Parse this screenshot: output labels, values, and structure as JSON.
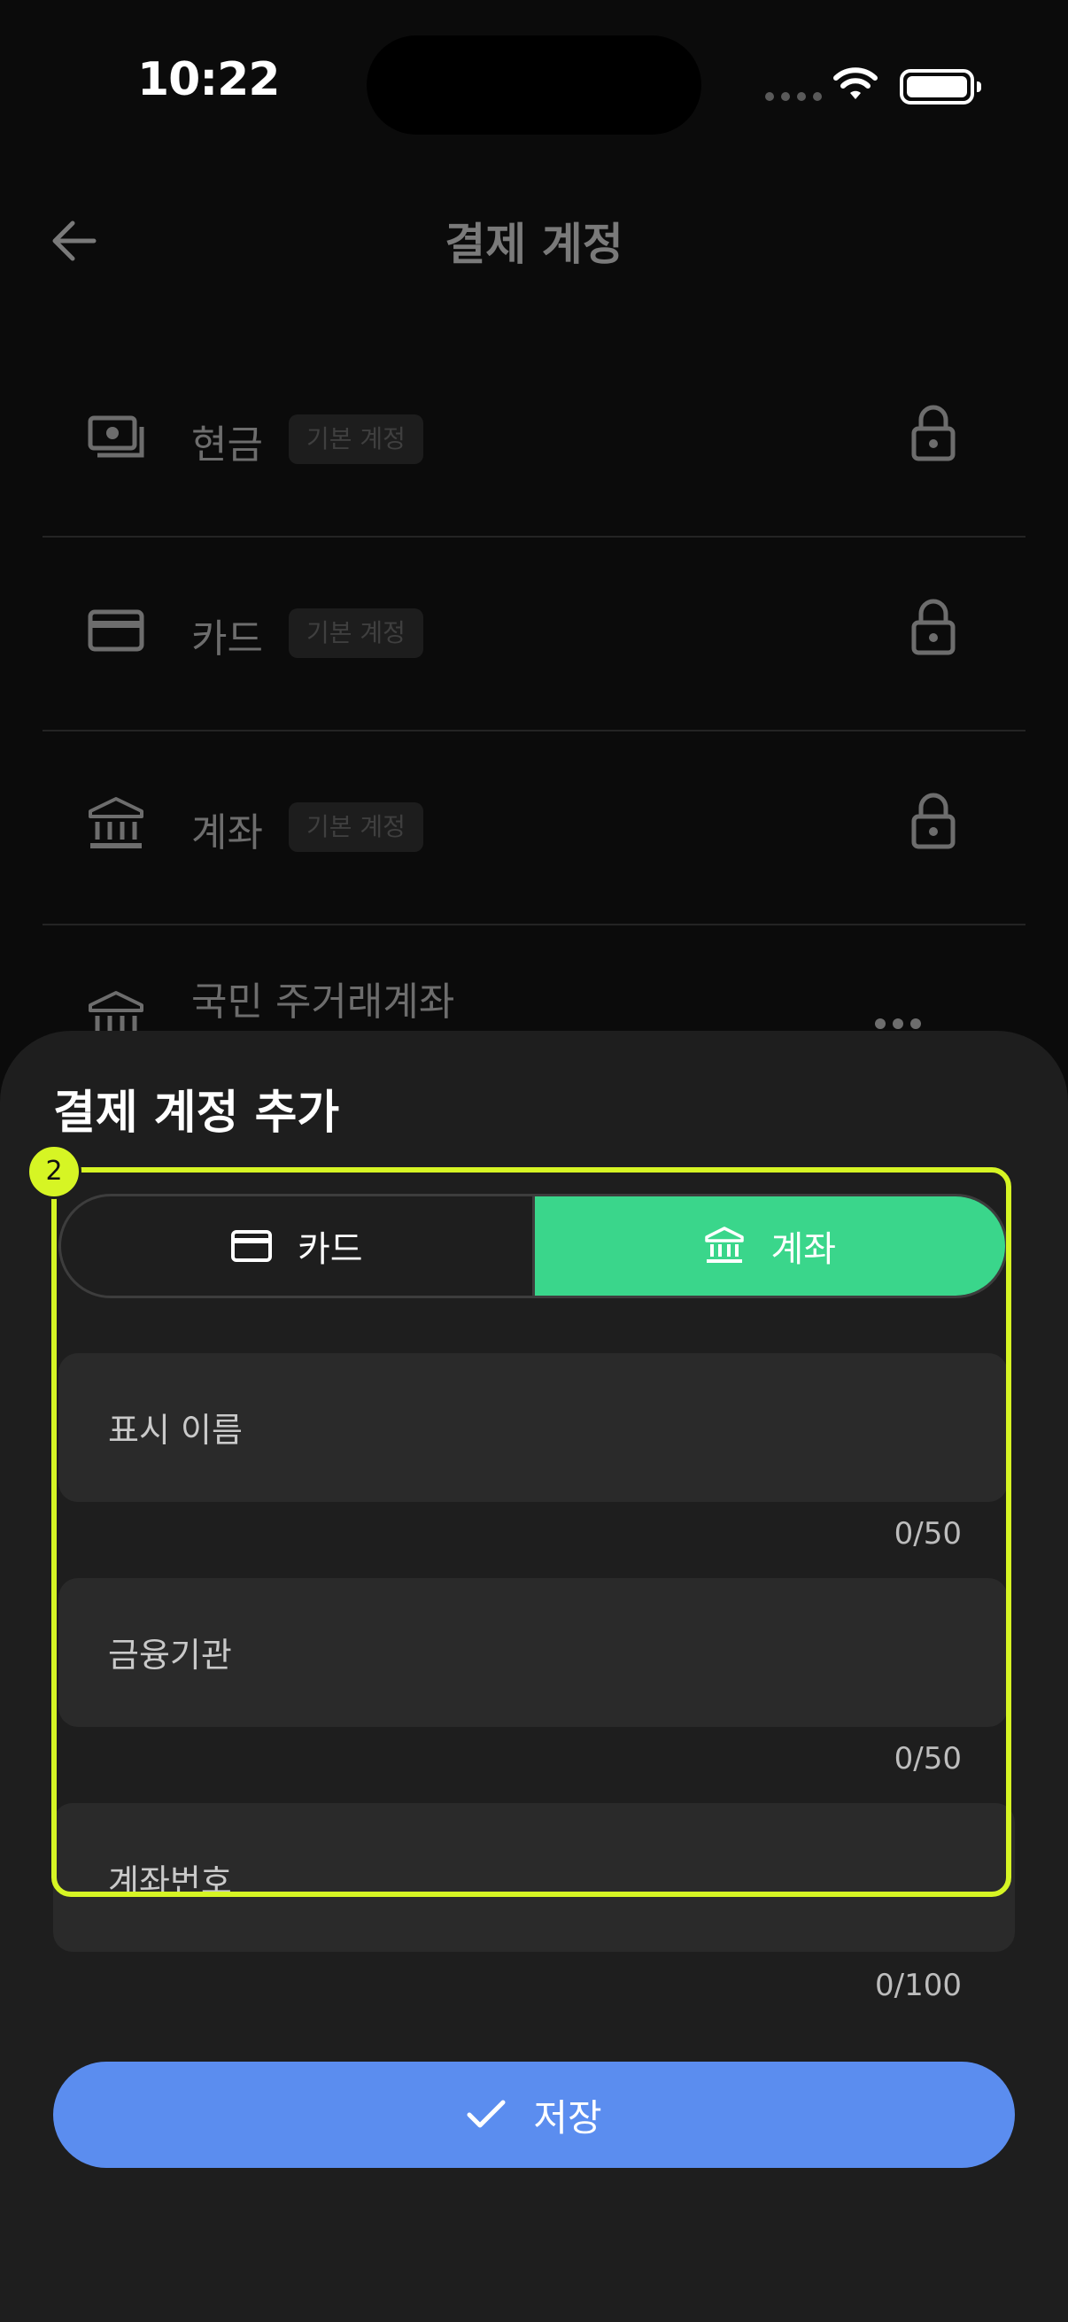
{
  "status_bar": {
    "time": "10:22"
  },
  "header": {
    "title": "결제 계정"
  },
  "accounts": [
    {
      "name": "현금",
      "badge": "기본 계정",
      "icon": "cash-icon",
      "locked": true
    },
    {
      "name": "카드",
      "badge": "기본 계정",
      "icon": "card-icon",
      "locked": true
    },
    {
      "name": "계좌",
      "badge": "기본 계정",
      "icon": "bank-icon",
      "locked": true
    },
    {
      "name": "국민 주거래계좌",
      "icon": "bank-icon",
      "locked": false
    }
  ],
  "sheet": {
    "title": "결제 계정 추가",
    "highlight_badge": "2",
    "segment": {
      "options": [
        {
          "label": "카드",
          "icon": "card-icon",
          "selected": false
        },
        {
          "label": "계좌",
          "icon": "bank-icon",
          "selected": true
        }
      ]
    },
    "fields": [
      {
        "label": "표시 이름",
        "value": "",
        "counter": "0/50"
      },
      {
        "label": "금융기관",
        "value": "",
        "counter": "0/50"
      },
      {
        "label": "계좌번호",
        "value": "",
        "counter": "0/100"
      }
    ],
    "save_label": "저장"
  },
  "colors": {
    "accent_green": "#3ad68b",
    "save_blue": "#5b8def",
    "highlight": "#d6f524",
    "sheet_bg": "#1e1e1e"
  }
}
